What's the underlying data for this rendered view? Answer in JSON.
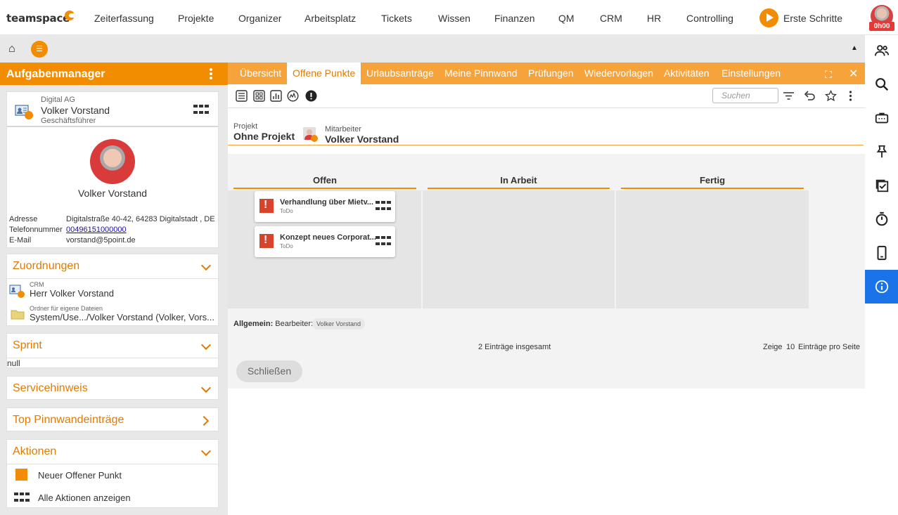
{
  "topnav": {
    "logo": "teamspace",
    "items": [
      "Zeiterfassung",
      "Projekte",
      "Organizer",
      "Arbeitsplatz",
      "Tickets",
      "Wissen",
      "Finanzen",
      "QM",
      "CRM",
      "HR",
      "Controlling"
    ],
    "erste_schritte": "Erste Schritte",
    "timer": "0h00"
  },
  "left": {
    "title": "Aufgabenmanager",
    "contact": {
      "company": "Digital AG",
      "name": "Volker Vorstand",
      "role": "Geschäftsführer",
      "display_name": "Volker Vorstand",
      "fields": [
        {
          "label": "Adresse",
          "value": "Digitalstraße 40-42, 64283 Digitalstadt , DE"
        },
        {
          "label": "Telefonnummer",
          "value": "00496151000000"
        },
        {
          "label": "E-Mail",
          "value": "vorstand@5point.de"
        }
      ]
    },
    "zuordnungen": {
      "title": "Zuordnungen",
      "crm_label": "CRM",
      "crm_value": "Herr Volker Vorstand",
      "folder_label": "Ordner für eigene Dateien",
      "folder_value": "System/Use.../Volker Vorstand (Volker, Vors..."
    },
    "sprint": {
      "title": "Sprint",
      "value": "null"
    },
    "servicehinweis": {
      "title": "Servicehinweis"
    },
    "top_pinnwand": {
      "title": "Top Pinnwandeinträge"
    },
    "aktionen": {
      "title": "Aktionen",
      "items": [
        "Neuer Offener Punkt",
        "Alle Aktionen anzeigen"
      ]
    }
  },
  "main": {
    "tabs": [
      "Übersicht",
      "Offene Punkte",
      "Urlaubsanträge",
      "Meine Pinnwand",
      "Prüfungen",
      "Wiedervorlagen",
      "Aktivitäten",
      "Einstellungen"
    ],
    "active_tab": "Offene Punkte",
    "search_placeholder": "Suchen",
    "filter": {
      "projekt_label": "Projekt",
      "projekt_value": "Ohne Projekt",
      "mitarbeiter_label": "Mitarbeiter",
      "mitarbeiter_value": "Volker Vorstand"
    },
    "columns": [
      "Offen",
      "In Arbeit",
      "Fertig"
    ],
    "tasks": [
      {
        "title": "Verhandlung über Mietv...",
        "status": "ToDo"
      },
      {
        "title": "Konzept neues Corporat...",
        "status": "ToDo"
      }
    ],
    "allgemein_label": "Allgemein:",
    "bearbeiter_label": "Bearbeiter:",
    "bearbeiter_chip": "Volker Vorstand",
    "total": "2 Einträge insgesamt",
    "zeige": "Zeige",
    "per_page": "10",
    "per_page_suffix": "Einträge pro Seite",
    "close_label": "Schließen"
  },
  "colors": {
    "accent": "#f28c00",
    "tab_bar": "#f5a33a",
    "active_rail": "#1a73e8"
  }
}
